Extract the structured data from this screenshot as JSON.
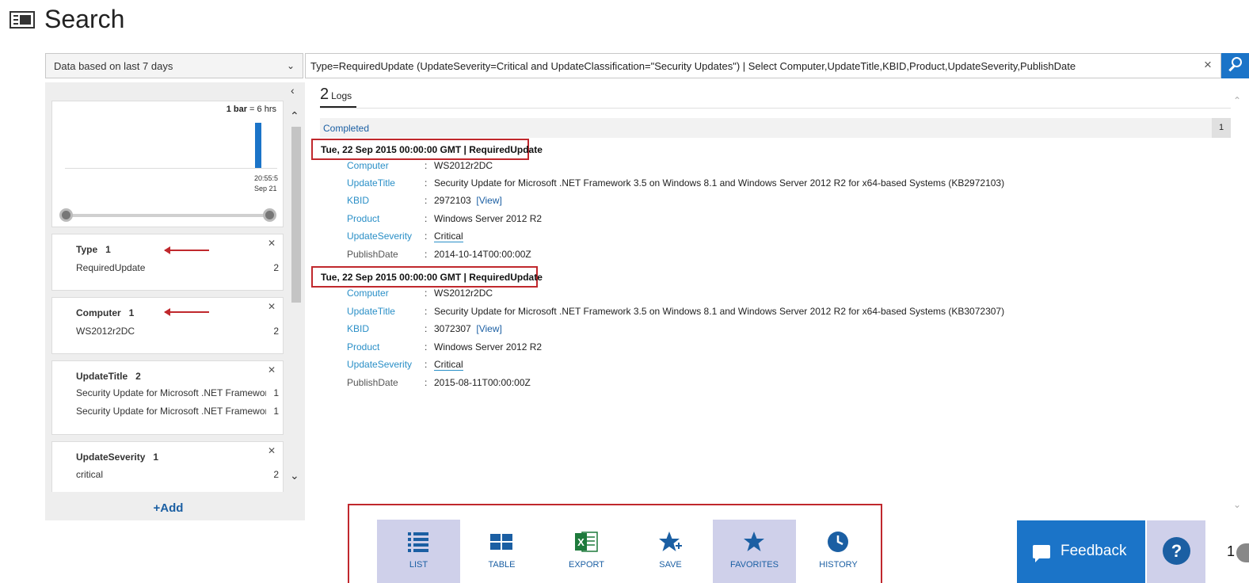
{
  "header": {
    "title": "Search",
    "icon": "search-window-icon"
  },
  "query": {
    "range_label": "Data based on last 7 days",
    "text": "Type=RequiredUpdate (UpdateSeverity=Critical and UpdateClassification=\"Security Updates\") | Select Computer,UpdateTitle,KBID,Product,UpdateSeverity,PublishDate",
    "clear_glyph": "×",
    "search_icon": "search-icon"
  },
  "histogram": {
    "legend_bold": "1 bar",
    "legend_rest": " = 6 hrs",
    "tick_time": "20:55:5",
    "tick_date": "Sep 21"
  },
  "facets": [
    {
      "name": "Type",
      "count": "1",
      "rows": [
        {
          "value": "RequiredUpdate",
          "count": "2"
        }
      ]
    },
    {
      "name": "Computer",
      "count": "1",
      "rows": [
        {
          "value": "WS2012r2DC",
          "count": "2"
        }
      ]
    },
    {
      "name": "UpdateTitle",
      "count": "2",
      "rows": [
        {
          "value": "Security Update for Microsoft .NET Framework...",
          "count": "1"
        },
        {
          "value": "Security Update for Microsoft .NET Framework...",
          "count": "1"
        }
      ]
    },
    {
      "name": "UpdateSeverity",
      "count": "1",
      "rows": [
        {
          "value": "critical",
          "count": "2"
        }
      ]
    }
  ],
  "add_label": "+Add",
  "results": {
    "count": "2",
    "count_label": "Logs",
    "status": "Completed",
    "page": "1",
    "records": [
      {
        "header": "Tue, 22 Sep 2015 00:00:00 GMT | RequiredUpdate",
        "computer_key": "Computer",
        "computer": "WS2012r2DC",
        "title_key": "UpdateTitle",
        "title": "Security Update for Microsoft .NET Framework 3.5 on Windows 8.1 and Windows Server 2012 R2 for x64-based Systems (KB2972103)",
        "kbid_key": "KBID",
        "kbid": "2972103",
        "kbid_link": "[View]",
        "product_key": "Product",
        "product": "Windows Server 2012 R2",
        "severity_key": "UpdateSeverity",
        "severity": "Critical",
        "publish_key": "PublishDate",
        "publish": "2014-10-14T00:00:00Z"
      },
      {
        "header": "Tue, 22 Sep 2015 00:00:00 GMT | RequiredUpdate",
        "computer_key": "Computer",
        "computer": "WS2012r2DC",
        "title_key": "UpdateTitle",
        "title": "Security Update for Microsoft .NET Framework 3.5 on Windows 8.1 and Windows Server 2012 R2 for x64-based Systems (KB3072307)",
        "kbid_key": "KBID",
        "kbid": "3072307",
        "kbid_link": "[View]",
        "product_key": "Product",
        "product": "Windows Server 2012 R2",
        "severity_key": "UpdateSeverity",
        "severity": "Critical",
        "publish_key": "PublishDate",
        "publish": "2015-08-11T00:00:00Z"
      }
    ],
    "separator": ":"
  },
  "toolbar": {
    "list": "LIST",
    "table": "TABLE",
    "export": "EXPORT",
    "save": "SAVE",
    "favorites": "FAVORITES",
    "history": "HISTORY"
  },
  "feedback_label": "Feedback",
  "help_glyph": "?",
  "corner_number": "1",
  "colors": {
    "accent": "#1b74c8",
    "annotation": "#c0282d",
    "active_tab": "#cfd0ea",
    "field_key": "#2a8fc7"
  }
}
